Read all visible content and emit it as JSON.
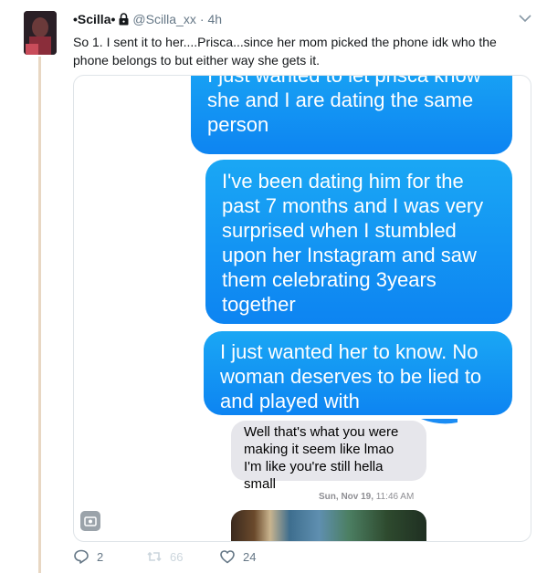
{
  "tweet": {
    "display_name": "•Scilla•",
    "handle": "@Scilla_xx",
    "separator": "·",
    "time": "4h",
    "text": "So 1. I sent it to her....Prisca...since her mom picked the phone idk who the phone belongs to but either way she gets it.",
    "reply_count": "2",
    "retweet_count": "66",
    "like_count": "24"
  },
  "screenshot": {
    "messages": [
      {
        "side": "sent",
        "text": "I just wanted to let prisca know she and I are dating the same person"
      },
      {
        "side": "sent",
        "text": "I've been dating him for the past 7 months and I was very surprised when I stumbled upon her Instagram and saw them celebrating 3years together"
      },
      {
        "side": "sent",
        "text": "I just wanted her to know. No woman deserves to be lied to and played with"
      },
      {
        "side": "received",
        "text": "Well that's what you were making it seem like lmao I'm like you're still hella small"
      }
    ],
    "timestamp_day": "Sun, Nov 19,",
    "timestamp_time": "11:46 AM"
  },
  "colors": {
    "imessage_blue": "#1a8cf4",
    "received_grey": "#e6e6eb",
    "thread_line": "#e8d7c3",
    "muted_text": "#657786"
  },
  "icons": {
    "lock": "lock-icon",
    "chevron": "chevron-down-icon",
    "reply": "reply-icon",
    "retweet": "retweet-icon",
    "like": "heart-icon"
  }
}
